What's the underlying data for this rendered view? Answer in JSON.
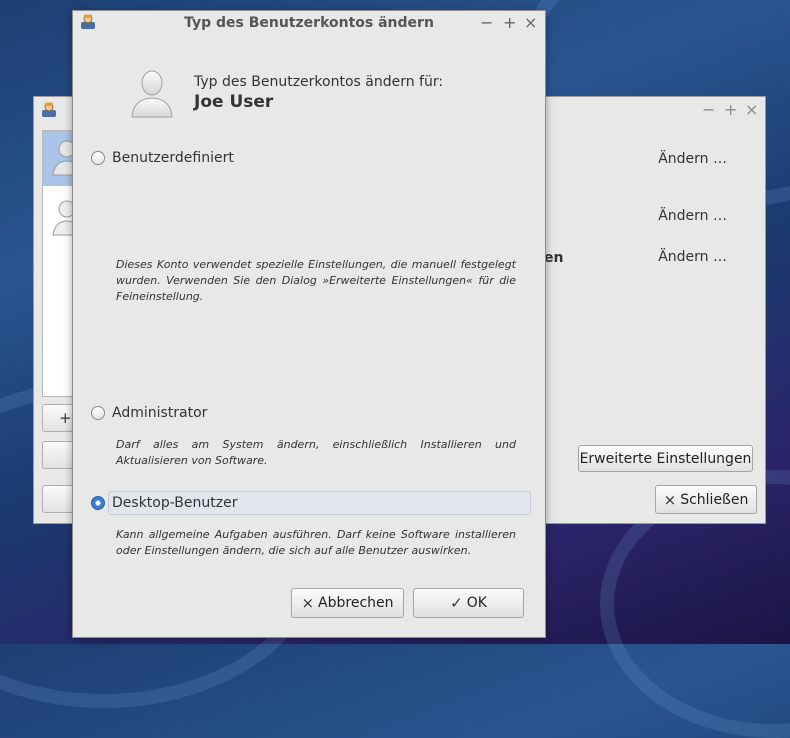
{
  "desktop": {
    "wallpaper_colors": [
      "#1d3f73",
      "#2a5590",
      "#2b2468"
    ]
  },
  "background_window": {
    "window_controls": [
      "−",
      "+",
      "×"
    ],
    "add_button_label": "+",
    "change_links": [
      "Ändern …",
      "Ändern …",
      "Ändern …"
    ],
    "partial_label": "en",
    "advanced_button_label": "Erweiterte Einstellungen",
    "close_button_label": "Schließen",
    "close_button_icon": "×"
  },
  "dialog": {
    "title": "Typ des Benutzerkontos ändern",
    "window_controls": [
      "−",
      "+",
      "×"
    ],
    "subtitle": "Typ des Benutzerkontos ändern für:",
    "username": "Joe User",
    "options": [
      {
        "label": "Benutzerdefiniert",
        "checked": false,
        "description": "Dieses Konto verwendet spezielle Einstellungen, die manuell festgelegt wurden. Verwenden Sie den Dialog »Erweiterte Einstellungen« für die Feineinstellung."
      },
      {
        "label": "Administrator",
        "checked": false,
        "description": "Darf alles am System ändern, einschließlich Installieren und Aktualisieren von Software."
      },
      {
        "label": "Desktop-Benutzer",
        "checked": true,
        "description": "Kann allgemeine Aufgaben ausführen. Darf keine Software installieren oder Einstellungen ändern, die sich auf alle Benutzer auswirken."
      }
    ],
    "cancel_button_label": "Abbrechen",
    "cancel_button_icon": "×",
    "ok_button_label": "OK",
    "ok_button_icon": "✓",
    "accent_color": "#3b7bd1"
  }
}
